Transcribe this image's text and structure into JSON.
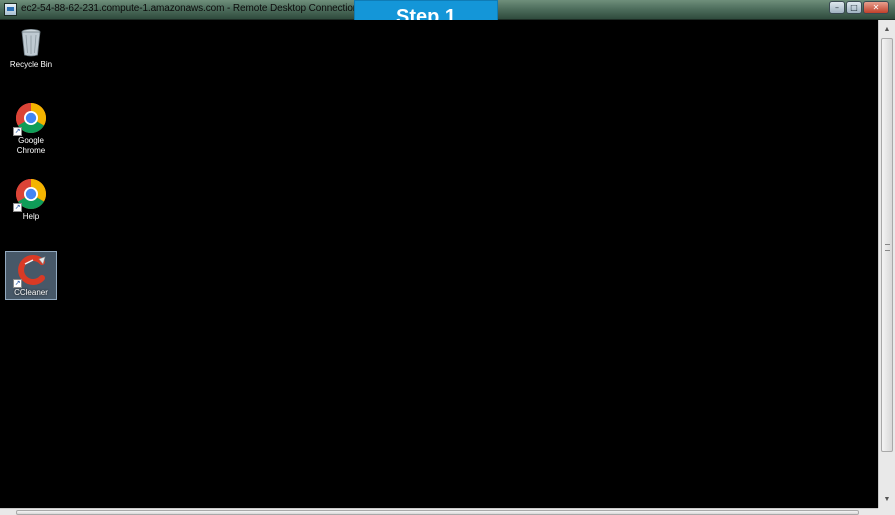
{
  "window": {
    "title": "ec2-54-88-62-231.compute-1.amazonaws.com - Remote Desktop Connection",
    "buttons": {
      "minimize": "–",
      "maximize": "□",
      "close": "✕"
    }
  },
  "overlay": {
    "step_label": "Step 1"
  },
  "desktop": {
    "items": [
      {
        "label": "Recycle Bin",
        "icon": "recycle-bin-icon"
      },
      {
        "label": "Google Chrome",
        "icon": "chrome-icon"
      },
      {
        "label": "Help",
        "icon": "chrome-icon"
      },
      {
        "label": "CCleaner",
        "icon": "ccleaner-icon"
      }
    ]
  },
  "colors": {
    "banner": "#1496d8",
    "desktop_background": "#000000",
    "selection": "#82a0be"
  }
}
